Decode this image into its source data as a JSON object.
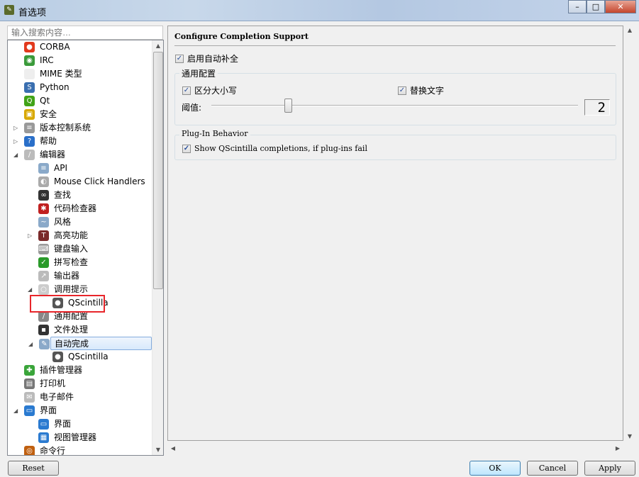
{
  "window": {
    "title": "首选项",
    "minimize": "–",
    "maximize": "□",
    "close": "✕"
  },
  "search": {
    "placeholder": "输入搜索内容…"
  },
  "tree": [
    {
      "label": "CORBA",
      "level": 0,
      "icon": "corba-icon",
      "glyph": "●",
      "color": "#e23a1e"
    },
    {
      "label": "IRC",
      "level": 0,
      "icon": "irc-chat-icon",
      "glyph": "◉",
      "color": "#3a9a3a"
    },
    {
      "label": "MIME 类型",
      "level": 0,
      "icon": "document-icon",
      "glyph": "",
      "color": "#eeeeee"
    },
    {
      "label": "Python",
      "level": 0,
      "icon": "python-icon",
      "glyph": "S",
      "color": "#3a6fb0"
    },
    {
      "label": "Qt",
      "level": 0,
      "icon": "qt-icon",
      "glyph": "Q",
      "color": "#41a317"
    },
    {
      "label": "安全",
      "level": 0,
      "icon": "lock-icon",
      "glyph": "▣",
      "color": "#d8a800"
    },
    {
      "label": "版本控制系统",
      "level": 0,
      "icon": "database-icon",
      "glyph": "≡",
      "color": "#999999",
      "expander": "collapsed"
    },
    {
      "label": "帮助",
      "level": 0,
      "icon": "help-icon",
      "glyph": "?",
      "color": "#2a6fc9",
      "expander": "collapsed"
    },
    {
      "label": "编辑器",
      "level": 0,
      "icon": "editor-pen-icon",
      "glyph": "/",
      "color": "#bbbbbb",
      "expander": "expanded"
    },
    {
      "label": "API",
      "level": 1,
      "icon": "api-icon",
      "glyph": "≡",
      "color": "#8aa9c9"
    },
    {
      "label": "Mouse Click Handlers",
      "level": 1,
      "icon": "mouse-icon",
      "glyph": "◐",
      "color": "#aaaaaa"
    },
    {
      "label": "查找",
      "level": 1,
      "icon": "binoculars-icon",
      "glyph": "∞",
      "color": "#333333"
    },
    {
      "label": "代码检查器",
      "level": 1,
      "icon": "bug-icon",
      "glyph": "✱",
      "color": "#c02020"
    },
    {
      "label": "风格",
      "level": 1,
      "icon": "style-icon",
      "glyph": "~",
      "color": "#8aa9c9"
    },
    {
      "label": "高亮功能",
      "level": 1,
      "icon": "highlight-text-icon",
      "glyph": "T",
      "color": "#7a2a2a",
      "expander": "collapsed"
    },
    {
      "label": "键盘输入",
      "level": 1,
      "icon": "keyboard-icon",
      "glyph": "⌨",
      "color": "#999999"
    },
    {
      "label": "拼写检查",
      "level": 1,
      "icon": "spellcheck-icon",
      "glyph": "✓",
      "color": "#2a9a2a"
    },
    {
      "label": "输出器",
      "level": 1,
      "icon": "exporter-icon",
      "glyph": "↗",
      "color": "#bbbbbb"
    },
    {
      "label": "调用提示",
      "level": 1,
      "icon": "lightbulb-icon",
      "glyph": "○",
      "color": "#cccccc",
      "expander": "expanded"
    },
    {
      "label": "QScintilla",
      "level": 2,
      "icon": "qscintilla-icon",
      "glyph": "●",
      "color": "#555555"
    },
    {
      "label": "通用配置",
      "level": 1,
      "icon": "wrench-icon",
      "glyph": "/",
      "color": "#888888"
    },
    {
      "label": "文件处理",
      "level": 1,
      "icon": "floppy-disk-icon",
      "glyph": "▪",
      "color": "#333333"
    },
    {
      "label": "自动完成",
      "level": 1,
      "icon": "autocomplete-wand-icon",
      "glyph": "✎",
      "color": "#8aa9c9",
      "expander": "expanded",
      "selected": true
    },
    {
      "label": "QScintilla",
      "level": 2,
      "icon": "qscintilla-icon",
      "glyph": "●",
      "color": "#555555"
    },
    {
      "label": "插件管理器",
      "level": 0,
      "icon": "puzzle-icon",
      "glyph": "✚",
      "color": "#3aa53a"
    },
    {
      "label": "打印机",
      "level": 0,
      "icon": "printer-icon",
      "glyph": "▤",
      "color": "#777777"
    },
    {
      "label": "电子邮件",
      "level": 0,
      "icon": "email-icon",
      "glyph": "✉",
      "color": "#bbbbbb"
    },
    {
      "label": "界面",
      "level": 0,
      "icon": "monitor-icon",
      "glyph": "▭",
      "color": "#2a7ad0",
      "expander": "expanded"
    },
    {
      "label": "界面",
      "level": 1,
      "icon": "monitor-icon",
      "glyph": "▭",
      "color": "#2a7ad0"
    },
    {
      "label": "视图管理器",
      "level": 1,
      "icon": "view-manager-icon",
      "glyph": "▦",
      "color": "#2a7ad0"
    },
    {
      "label": "命令行",
      "level": 0,
      "icon": "shell-icon",
      "glyph": "◎",
      "color": "#c06010"
    }
  ],
  "page": {
    "heading": "Configure Completion Support",
    "enable": {
      "label": "启用自动补全",
      "checked": true
    },
    "general": {
      "title": "通用配置",
      "case_sensitive": {
        "label": "区分大小写",
        "checked": true
      },
      "replace_word": {
        "label": "替换文字",
        "checked": true
      },
      "threshold_label": "阈值:",
      "threshold_value": "2"
    },
    "plugin": {
      "title": "Plug-In Behavior",
      "fallback": {
        "label": "Show QScintilla completions, if plug-ins fail",
        "checked": true
      }
    }
  },
  "buttons": {
    "reset": "Reset",
    "ok": "OK",
    "cancel": "Cancel",
    "apply": "Apply"
  },
  "check_glyph": "✓",
  "arrows": {
    "up": "▲",
    "down": "▼",
    "left": "◀",
    "right": "▶",
    "collapsed": "▷",
    "expanded": "◢"
  }
}
